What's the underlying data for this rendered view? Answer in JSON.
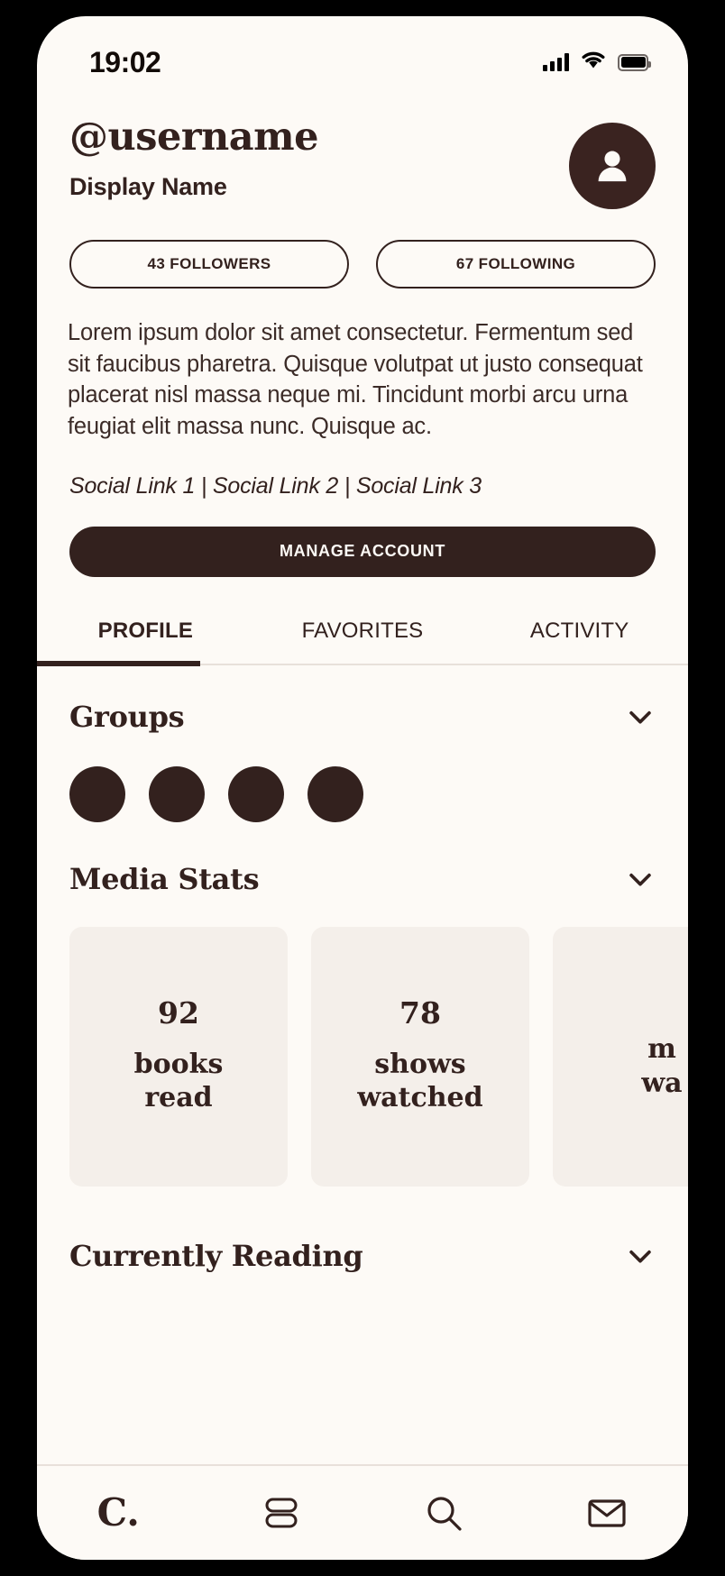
{
  "status_bar": {
    "time": "19:02",
    "signal_icon": "signal-bars-icon",
    "wifi_icon": "wifi-icon",
    "battery_icon": "battery-icon"
  },
  "profile": {
    "username": "@username",
    "display_name": "Display Name",
    "avatar_icon": "person-icon",
    "followers_label": "43 FOLLOWERS",
    "following_label": "67 FOLLOWING",
    "bio": "Lorem ipsum dolor sit amet consectetur. Fermentum sed sit faucibus pharetra. Quisque volutpat ut justo consequat placerat nisl massa neque mi. Tincidunt morbi arcu urna feugiat elit massa nunc. Quisque ac.",
    "social_links": "Social Link 1 | Social Link 2 | Social Link 3",
    "manage_label": "MANAGE ACCOUNT"
  },
  "tabs": [
    {
      "label": "PROFILE",
      "active": true
    },
    {
      "label": "FAVORITES",
      "active": false
    },
    {
      "label": "ACTIVITY",
      "active": false
    }
  ],
  "sections": {
    "groups": {
      "title": "Groups",
      "chevron_icon": "chevron-down-icon",
      "items": [
        {
          "name": "group-avatar-1"
        },
        {
          "name": "group-avatar-2"
        },
        {
          "name": "group-avatar-3"
        },
        {
          "name": "group-avatar-4"
        }
      ]
    },
    "media_stats": {
      "title": "Media Stats",
      "chevron_icon": "chevron-down-icon",
      "cards": [
        {
          "value": "92",
          "label_line1": "books",
          "label_line2": "read"
        },
        {
          "value": "78",
          "label_line1": "shows",
          "label_line2": "watched"
        },
        {
          "value": "",
          "label_line1": "m",
          "label_line2": "wa"
        }
      ]
    },
    "currently_reading": {
      "title": "Currently Reading",
      "chevron_icon": "chevron-down-icon"
    }
  },
  "bottom_nav": [
    {
      "name": "nav-home-logo",
      "label": "C.",
      "icon": "logo-c-icon"
    },
    {
      "name": "nav-library",
      "label": "",
      "icon": "stacked-books-icon"
    },
    {
      "name": "nav-search",
      "label": "",
      "icon": "search-icon"
    },
    {
      "name": "nav-messages",
      "label": "",
      "icon": "envelope-icon"
    }
  ],
  "colors": {
    "background": "#FDFAF6",
    "brand_dark": "#33211e",
    "card_bg": "#F4EFEA",
    "divider": "#e8e0da"
  }
}
